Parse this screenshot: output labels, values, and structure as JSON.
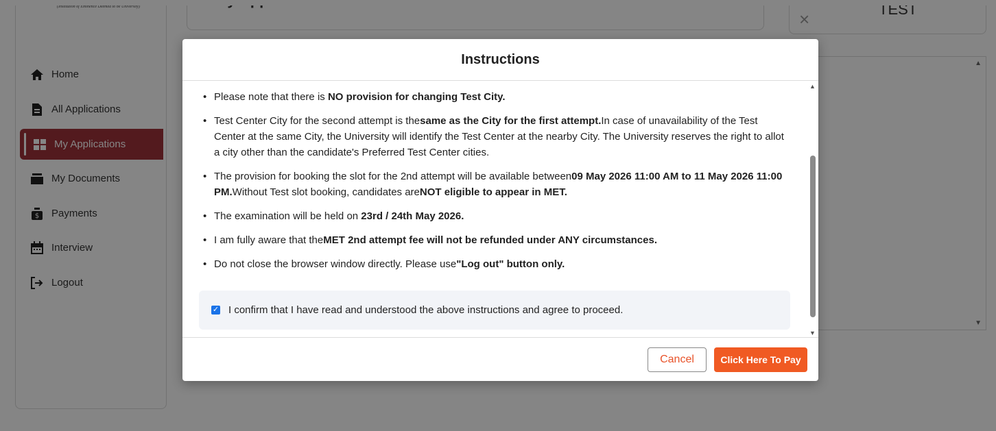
{
  "background": {
    "sidebar_tagline": "(Institution of Eminence Deemed to be University)",
    "top_card_title": "My Applications",
    "right_card_label": "TEST",
    "right_card_close": "×"
  },
  "sidebar": {
    "items": [
      {
        "label": "Home",
        "icon": "home-icon"
      },
      {
        "label": "All Applications",
        "icon": "file-icon"
      },
      {
        "label": "My Applications",
        "icon": "grid-icon",
        "active": true
      },
      {
        "label": "My Documents",
        "icon": "stack-icon"
      },
      {
        "label": "Payments",
        "icon": "money-bag-icon"
      },
      {
        "label": "Interview",
        "icon": "calendar-icon"
      },
      {
        "label": "Logout",
        "icon": "logout-icon"
      }
    ]
  },
  "modal": {
    "title": "Instructions",
    "instructions": [
      {
        "pre": "Please note that there is ",
        "bold": "NO provision for changing Test City.",
        "post": ""
      },
      {
        "pre": "Test Center City for the second attempt is the",
        "bold": "same as the City for the first attempt.",
        "post": "In case of unavailability of the Test Center at the same City, the University will identify the Test Center at the nearby City. The University reserves the right to allot a city other than the candidate's Preferred Test Center cities."
      },
      {
        "pre": "The provision for booking the slot for the 2nd attempt will be available between",
        "bold": "09 May 2026 11:00 AM to 11 May 2026 11:00 PM.",
        "post": "Without Test slot booking, candidates are",
        "bold2": "NOT eligible to appear in MET."
      },
      {
        "pre": "The examination will be held on ",
        "bold": "23rd / 24th May 2026.",
        "post": ""
      },
      {
        "pre": "I am fully aware that the",
        "bold": "MET 2nd attempt fee will not be refunded under ANY circumstances.",
        "post": ""
      },
      {
        "pre": "Do not close the browser window directly. Please use",
        "bold": "\"Log out\" button only.",
        "post": ""
      }
    ],
    "confirm_text": "I confirm that I have read and understood the above instructions and agree to proceed.",
    "confirm_checked": true,
    "cancel_label": "Cancel",
    "pay_label": "Click Here To Pay"
  },
  "colors": {
    "accent": "#a0323a",
    "pay_button": "#f05a23",
    "cancel_text": "#e8532a",
    "checkbox": "#1a73e8"
  }
}
